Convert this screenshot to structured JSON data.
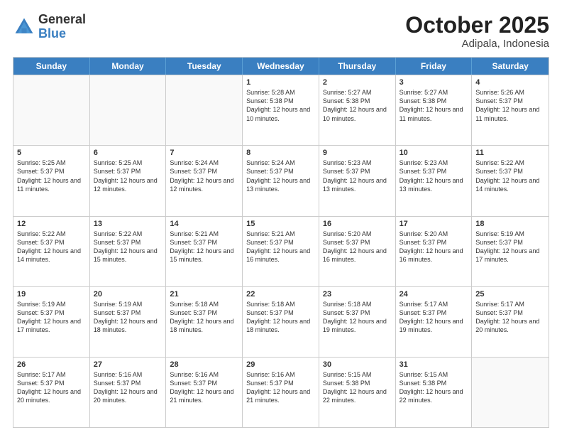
{
  "header": {
    "logo": {
      "general": "General",
      "blue": "Blue"
    },
    "title": "October 2025",
    "location": "Adipala, Indonesia"
  },
  "weekdays": [
    "Sunday",
    "Monday",
    "Tuesday",
    "Wednesday",
    "Thursday",
    "Friday",
    "Saturday"
  ],
  "rows": [
    [
      {
        "day": "",
        "info": ""
      },
      {
        "day": "",
        "info": ""
      },
      {
        "day": "",
        "info": ""
      },
      {
        "day": "1",
        "info": "Sunrise: 5:28 AM\nSunset: 5:38 PM\nDaylight: 12 hours\nand 10 minutes."
      },
      {
        "day": "2",
        "info": "Sunrise: 5:27 AM\nSunset: 5:38 PM\nDaylight: 12 hours\nand 10 minutes."
      },
      {
        "day": "3",
        "info": "Sunrise: 5:27 AM\nSunset: 5:38 PM\nDaylight: 12 hours\nand 11 minutes."
      },
      {
        "day": "4",
        "info": "Sunrise: 5:26 AM\nSunset: 5:37 PM\nDaylight: 12 hours\nand 11 minutes."
      }
    ],
    [
      {
        "day": "5",
        "info": "Sunrise: 5:25 AM\nSunset: 5:37 PM\nDaylight: 12 hours\nand 11 minutes."
      },
      {
        "day": "6",
        "info": "Sunrise: 5:25 AM\nSunset: 5:37 PM\nDaylight: 12 hours\nand 12 minutes."
      },
      {
        "day": "7",
        "info": "Sunrise: 5:24 AM\nSunset: 5:37 PM\nDaylight: 12 hours\nand 12 minutes."
      },
      {
        "day": "8",
        "info": "Sunrise: 5:24 AM\nSunset: 5:37 PM\nDaylight: 12 hours\nand 13 minutes."
      },
      {
        "day": "9",
        "info": "Sunrise: 5:23 AM\nSunset: 5:37 PM\nDaylight: 12 hours\nand 13 minutes."
      },
      {
        "day": "10",
        "info": "Sunrise: 5:23 AM\nSunset: 5:37 PM\nDaylight: 12 hours\nand 13 minutes."
      },
      {
        "day": "11",
        "info": "Sunrise: 5:22 AM\nSunset: 5:37 PM\nDaylight: 12 hours\nand 14 minutes."
      }
    ],
    [
      {
        "day": "12",
        "info": "Sunrise: 5:22 AM\nSunset: 5:37 PM\nDaylight: 12 hours\nand 14 minutes."
      },
      {
        "day": "13",
        "info": "Sunrise: 5:22 AM\nSunset: 5:37 PM\nDaylight: 12 hours\nand 15 minutes."
      },
      {
        "day": "14",
        "info": "Sunrise: 5:21 AM\nSunset: 5:37 PM\nDaylight: 12 hours\nand 15 minutes."
      },
      {
        "day": "15",
        "info": "Sunrise: 5:21 AM\nSunset: 5:37 PM\nDaylight: 12 hours\nand 16 minutes."
      },
      {
        "day": "16",
        "info": "Sunrise: 5:20 AM\nSunset: 5:37 PM\nDaylight: 12 hours\nand 16 minutes."
      },
      {
        "day": "17",
        "info": "Sunrise: 5:20 AM\nSunset: 5:37 PM\nDaylight: 12 hours\nand 16 minutes."
      },
      {
        "day": "18",
        "info": "Sunrise: 5:19 AM\nSunset: 5:37 PM\nDaylight: 12 hours\nand 17 minutes."
      }
    ],
    [
      {
        "day": "19",
        "info": "Sunrise: 5:19 AM\nSunset: 5:37 PM\nDaylight: 12 hours\nand 17 minutes."
      },
      {
        "day": "20",
        "info": "Sunrise: 5:19 AM\nSunset: 5:37 PM\nDaylight: 12 hours\nand 18 minutes."
      },
      {
        "day": "21",
        "info": "Sunrise: 5:18 AM\nSunset: 5:37 PM\nDaylight: 12 hours\nand 18 minutes."
      },
      {
        "day": "22",
        "info": "Sunrise: 5:18 AM\nSunset: 5:37 PM\nDaylight: 12 hours\nand 18 minutes."
      },
      {
        "day": "23",
        "info": "Sunrise: 5:18 AM\nSunset: 5:37 PM\nDaylight: 12 hours\nand 19 minutes."
      },
      {
        "day": "24",
        "info": "Sunrise: 5:17 AM\nSunset: 5:37 PM\nDaylight: 12 hours\nand 19 minutes."
      },
      {
        "day": "25",
        "info": "Sunrise: 5:17 AM\nSunset: 5:37 PM\nDaylight: 12 hours\nand 20 minutes."
      }
    ],
    [
      {
        "day": "26",
        "info": "Sunrise: 5:17 AM\nSunset: 5:37 PM\nDaylight: 12 hours\nand 20 minutes."
      },
      {
        "day": "27",
        "info": "Sunrise: 5:16 AM\nSunset: 5:37 PM\nDaylight: 12 hours\nand 20 minutes."
      },
      {
        "day": "28",
        "info": "Sunrise: 5:16 AM\nSunset: 5:37 PM\nDaylight: 12 hours\nand 21 minutes."
      },
      {
        "day": "29",
        "info": "Sunrise: 5:16 AM\nSunset: 5:37 PM\nDaylight: 12 hours\nand 21 minutes."
      },
      {
        "day": "30",
        "info": "Sunrise: 5:15 AM\nSunset: 5:38 PM\nDaylight: 12 hours\nand 22 minutes."
      },
      {
        "day": "31",
        "info": "Sunrise: 5:15 AM\nSunset: 5:38 PM\nDaylight: 12 hours\nand 22 minutes."
      },
      {
        "day": "",
        "info": ""
      }
    ]
  ]
}
